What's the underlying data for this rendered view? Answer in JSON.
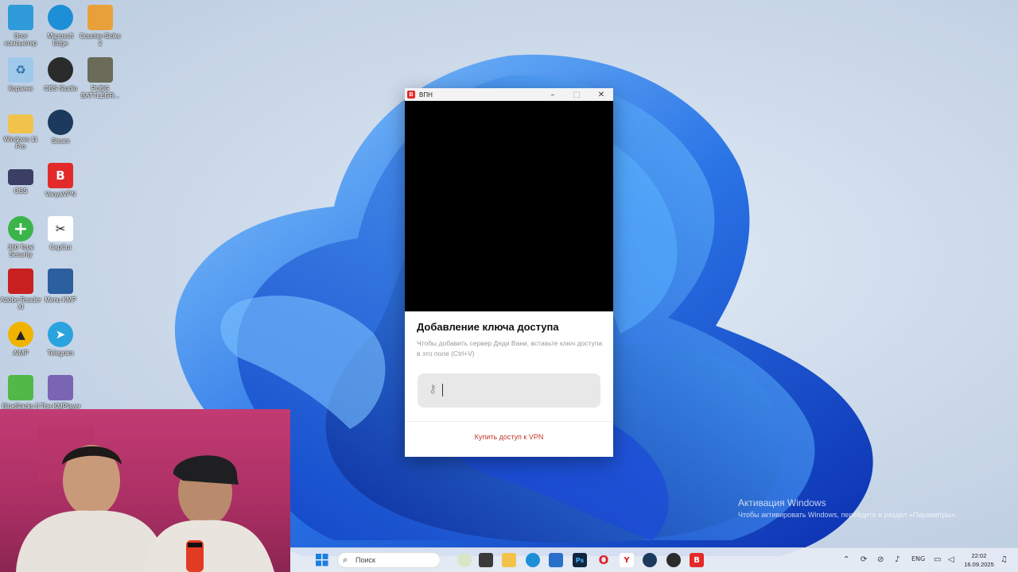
{
  "desktop_icons": [
    {
      "label": "Этот компьютер",
      "icon": "computer-icon",
      "color": "#2f9bd8"
    },
    {
      "label": "Microsoft Edge",
      "icon": "edge-icon",
      "color": "#1d8fd6"
    },
    {
      "label": "Counter-Strike 2",
      "icon": "cs2-icon",
      "color": "#e8a13a"
    },
    {
      "label": "Корзина",
      "icon": "recycle-bin-icon",
      "color": "#9fc9ea"
    },
    {
      "label": "OBS Studio",
      "icon": "obs-icon",
      "color": "#2b2b2b"
    },
    {
      "label": "PUBG BATTLEGR...",
      "icon": "pubg-icon",
      "color": "#6b6b5a"
    },
    {
      "label": "Windows 11 Pro",
      "icon": "folder-icon",
      "color": "#f2c34b"
    },
    {
      "label": "Steam",
      "icon": "steam-icon",
      "color": "#1b3a5c"
    },
    {
      "label": "OBS",
      "icon": "obs-shortcut-icon",
      "color": "#3b3f66"
    },
    {
      "label": "VanyaVPN",
      "icon": "vanyavpn-icon",
      "color": "#e32a2a",
      "glyph": "B"
    },
    {
      "label": "360 Total Security",
      "icon": "360-security-icon",
      "color": "#3bb54a",
      "glyph": "+"
    },
    {
      "label": "CapCut",
      "icon": "capcut-icon",
      "color": "#ffffff"
    },
    {
      "label": "Adobe Reader XI",
      "icon": "adobe-reader-icon",
      "color": "#c8201e"
    },
    {
      "label": "Menu KMP",
      "icon": "kmp-menu-icon",
      "color": "#2b5f9e"
    },
    {
      "label": "AIMP",
      "icon": "aimp-icon",
      "color": "#f0b400"
    },
    {
      "label": "Telegram",
      "icon": "telegram-icon",
      "color": "#2aa3de"
    },
    {
      "label": "BlueStacks 5",
      "icon": "bluestacks-icon",
      "color": "#52b948"
    },
    {
      "label": "The KMPlayer",
      "icon": "kmplayer-icon",
      "color": "#7a64b4"
    }
  ],
  "vpn_window": {
    "title": "ВПН",
    "app_glyph": "B",
    "minimize": "–",
    "maximize": "□",
    "close": "✕",
    "heading": "Добавление ключа доступа",
    "description": "Чтобы добавить сервер Дяди Вани, вставьте ключ доступа в это поле (Ctrl+V)",
    "key_icon": "⚷",
    "buy_link": "Купить доступ к VPN"
  },
  "watermark": {
    "title": "Активация Windows",
    "subtitle": "Чтобы активировать Windows, перейдите в раздел «Параметры»."
  },
  "taskbar": {
    "search_label": "Поиск",
    "language": "ENG",
    "time": "22:02",
    "date": "16.09.2025"
  },
  "colors": {
    "accent_red": "#e32a2a",
    "link_red": "#c0392b",
    "webcam_bg": "#b23466"
  }
}
